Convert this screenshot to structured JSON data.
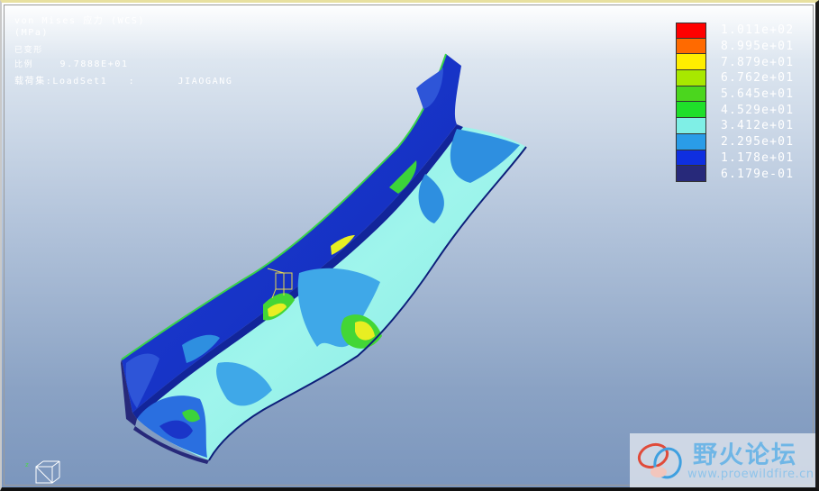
{
  "result_info": {
    "quantity": "von Mises 应力 (WCS)",
    "unit": "(MPa)",
    "state": "已变形",
    "scale_label": "比例",
    "scale_value": "9.7888E+01",
    "loadset_label": "载荷集:LoadSet1",
    "loadset_sep": ":",
    "model_name": "JIAOGANG"
  },
  "legend": [
    {
      "value": "1.011e+02",
      "color": "#ff0000"
    },
    {
      "value": "8.995e+01",
      "color": "#ff6a00"
    },
    {
      "value": "7.879e+01",
      "color": "#ffee00"
    },
    {
      "value": "6.762e+01",
      "color": "#a8e800"
    },
    {
      "value": "5.645e+01",
      "color": "#4bd61e"
    },
    {
      "value": "4.529e+01",
      "color": "#1fdf2a"
    },
    {
      "value": "3.412e+01",
      "color": "#7fefe6"
    },
    {
      "value": "2.295e+01",
      "color": "#2a9ce8"
    },
    {
      "value": "1.178e+01",
      "color": "#0f2fe0"
    },
    {
      "value": "6.179e-01",
      "color": "#27297a"
    }
  ],
  "watermark": {
    "title": "野火论坛",
    "url": "www.proewildfire.cn"
  },
  "colors": {
    "dark_blue": "#1b2fd0",
    "cyan_light": "#8ff3ea",
    "mid_blue": "#2e8fe0",
    "green": "#3cd33a",
    "yellow": "#e8ee22",
    "navy": "#27297a"
  }
}
